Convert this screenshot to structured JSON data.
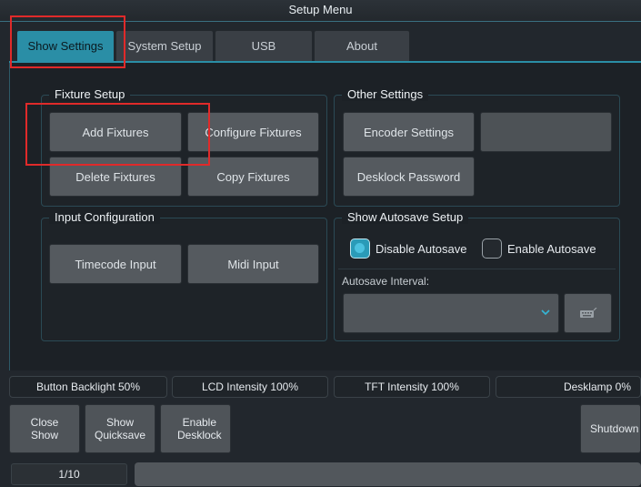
{
  "window": {
    "title": "Setup Menu"
  },
  "tabs": [
    {
      "label": "Show Settings"
    },
    {
      "label": "System Setup"
    },
    {
      "label": "USB"
    },
    {
      "label": "About"
    }
  ],
  "fixture_setup": {
    "title": "Fixture Setup",
    "add": "Add Fixtures",
    "configure": "Configure Fixtures",
    "delete": "Delete Fixtures",
    "copy": "Copy Fixtures"
  },
  "other_settings": {
    "title": "Other Settings",
    "encoder": "Encoder Settings",
    "desklock": "Desklock Password"
  },
  "input_config": {
    "title": "Input Configuration",
    "timecode": "Timecode Input",
    "midi": "Midi Input"
  },
  "autosave": {
    "title": "Show Autosave Setup",
    "disable": "Disable Autosave",
    "enable": "Enable Autosave",
    "interval_label": "Autosave Interval:"
  },
  "status": {
    "backlight": "Button Backlight 50%",
    "lcd": "LCD Intensity 100%",
    "tft": "TFT Intensity 100%",
    "desklamp": "Desklamp 0%"
  },
  "bottom": {
    "close_show": "Close\nShow",
    "quicksave": "Show\nQuicksave",
    "desklock": "Enable\nDesklock",
    "shutdown": "Shutdown"
  },
  "page": {
    "indicator": "1/10"
  },
  "colors": {
    "accent": "#2a8ea6",
    "highlight": "#e02a2a"
  },
  "icons": {
    "dropdown": "chevron-down-icon",
    "keyboard": "keyboard-icon"
  }
}
